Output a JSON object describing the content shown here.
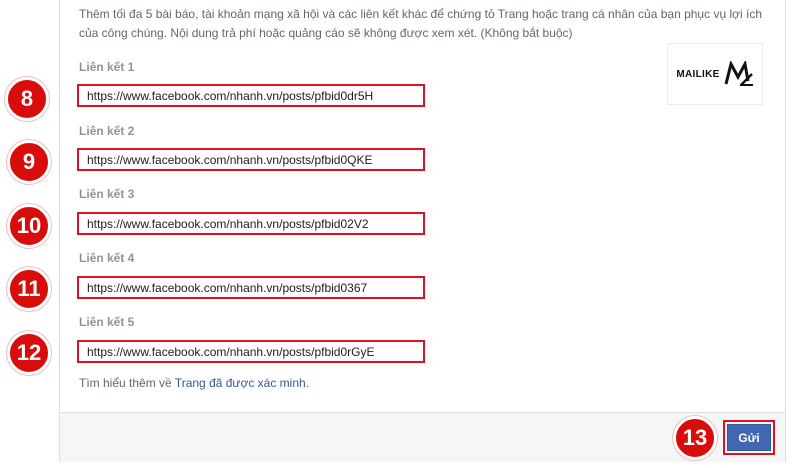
{
  "description": "Thêm tối đa 5 bài báo, tài khoản mạng xã hội và các liên kết khác để chứng tỏ Trang hoặc trang cá nhân của bạn phục vụ lợi ích của công chúng. Nội dung trả phí hoặc quảng cáo sẽ không được xem xét. (Không bắt buộc)",
  "links": [
    {
      "step": "8",
      "label": "Liên kết 1",
      "value": "https://www.facebook.com/nhanh.vn/posts/pfbid0dr5H"
    },
    {
      "step": "9",
      "label": "Liên kết 2",
      "value": "https://www.facebook.com/nhanh.vn/posts/pfbid0QKE"
    },
    {
      "step": "10",
      "label": "Liên kết 3",
      "value": "https://www.facebook.com/nhanh.vn/posts/pfbid02V2"
    },
    {
      "step": "11",
      "label": "Liên kết 4",
      "value": "https://www.facebook.com/nhanh.vn/posts/pfbid0367"
    },
    {
      "step": "12",
      "label": "Liên kết 5",
      "value": "https://www.facebook.com/nhanh.vn/posts/pfbid0rGyE"
    }
  ],
  "learn_more": {
    "prefix": "Tìm hiểu thêm về ",
    "link": "Trang đã được xác minh",
    "suffix": "."
  },
  "submit": {
    "label": "Gửi",
    "step": "13"
  },
  "logo": {
    "text": "MAILIKE"
  },
  "colors": {
    "accent_red": "#d90c0c",
    "button_blue": "#4267b2",
    "link_blue": "#365899"
  }
}
